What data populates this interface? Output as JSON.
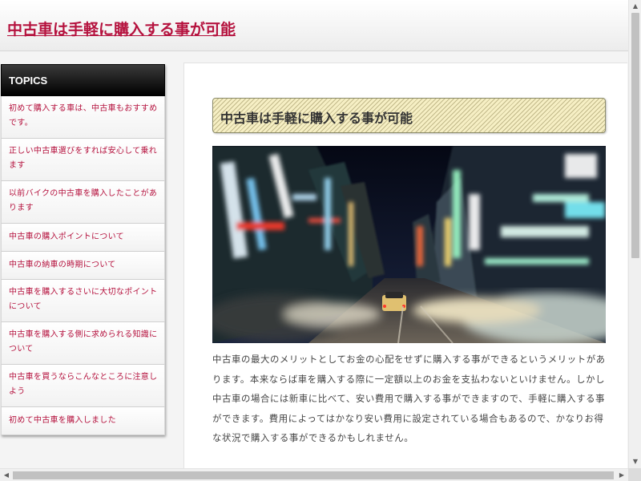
{
  "header": {
    "site_title": "中古車は手軽に購入する事が可能"
  },
  "sidebar": {
    "heading": "TOPICS",
    "items": [
      {
        "label": "初めて購入する車は、中古車もおすすめです。"
      },
      {
        "label": "正しい中古車選びをすれば安心して乗れます"
      },
      {
        "label": "以前バイクの中古車を購入したことがあります"
      },
      {
        "label": "中古車の購入ポイントについて"
      },
      {
        "label": "中古車の納車の時期について"
      },
      {
        "label": "中古車を購入するさいに大切なポイントについて"
      },
      {
        "label": "中古車を購入する側に求められる知識について"
      },
      {
        "label": "中古車を買うならこんなところに注意しよう"
      },
      {
        "label": "初めて中古車を購入しました"
      }
    ]
  },
  "article": {
    "title": "中古車は手軽に購入する事が可能",
    "paragraph": "中古車の最大のメリットとしてお金の心配をせずに購入する事ができるというメリットがあります。本来ならば車を購入する際に一定額以上のお金を支払わないといけません。しかし中古車の場合には新車に比べて、安い費用で購入する事ができますので、手軽に購入する事ができます。費用によってはかなり安い費用に設定されている場合もあるので、かなりお得な状況で購入する事ができるかもしれません。"
  },
  "colors": {
    "accent": "#b5123e",
    "title_box_bg": "#f6efc4"
  },
  "icons": {
    "scroll_up": "▲",
    "scroll_down": "▼",
    "scroll_left": "◀",
    "scroll_right": "▶"
  }
}
